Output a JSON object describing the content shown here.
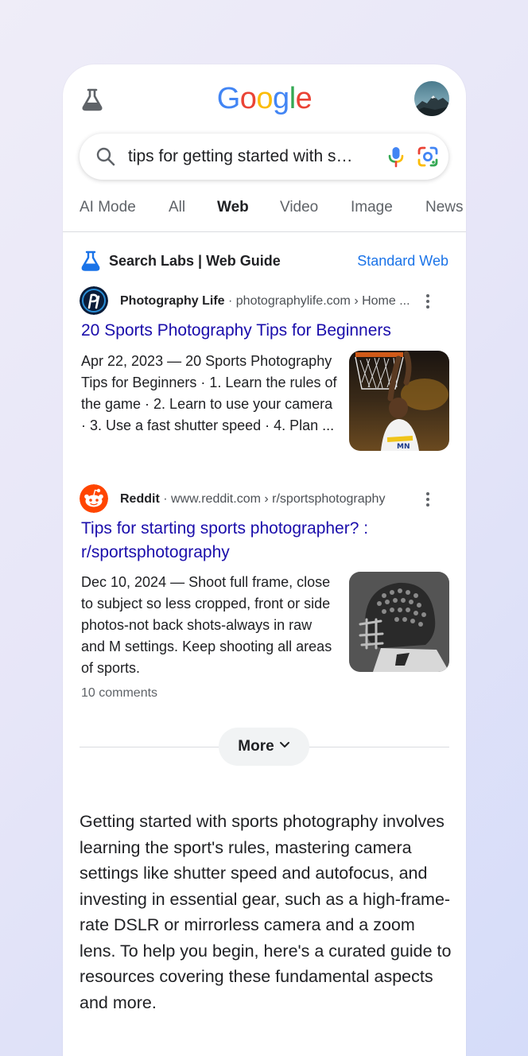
{
  "header": {
    "logo": [
      "G",
      "o",
      "o",
      "g",
      "l",
      "e"
    ],
    "logo_colors": [
      "#4285F4",
      "#EA4335",
      "#FBBC05",
      "#4285F4",
      "#34A853",
      "#EA4335"
    ]
  },
  "search": {
    "query": "tips for getting started with sports photography"
  },
  "tabs": [
    {
      "label": "AI Mode"
    },
    {
      "label": "All"
    },
    {
      "label": "Web",
      "active": true
    },
    {
      "label": "Video"
    },
    {
      "label": "Image"
    },
    {
      "label": "News"
    }
  ],
  "labs": {
    "title": "Search Labs | Web Guide",
    "link": "Standard Web"
  },
  "results": [
    {
      "site_name": "Photography Life",
      "url": " · photographylife.com › Home ...",
      "title": "20 Sports Photography Tips for Beginners",
      "snippet": "Apr 22, 2023 — 20 Sports Photography Tips for Beginners · 1. Learn the rules of the game · 2. Learn to use your camera · 3. Use a fast shutter speed · 4. Plan ...",
      "thumbnail": "basketball-dunk-image"
    },
    {
      "site_name": "Reddit",
      "url": " · www.reddit.com › r/sportsphotography",
      "title": "Tips for starting sports photographer? : r/sportsphotography",
      "snippet": "Dec 10, 2024 — Shoot full frame, close to subject so less cropped, front or side photos-not back shots-always in raw and M settings. Keep shooting all areas of sports.",
      "comments": "10 comments",
      "thumbnail": "football-helmet-image"
    }
  ],
  "more": {
    "label": "More"
  },
  "summary": "Getting started with sports photography involves learning the sport's rules, mastering camera settings like shutter speed and autofocus, and investing in essential gear, such as a high-frame-rate DSLR or mirrorless camera and a zoom lens. To help you begin, here's a curated guide to resources covering these fundamental aspects and more."
}
